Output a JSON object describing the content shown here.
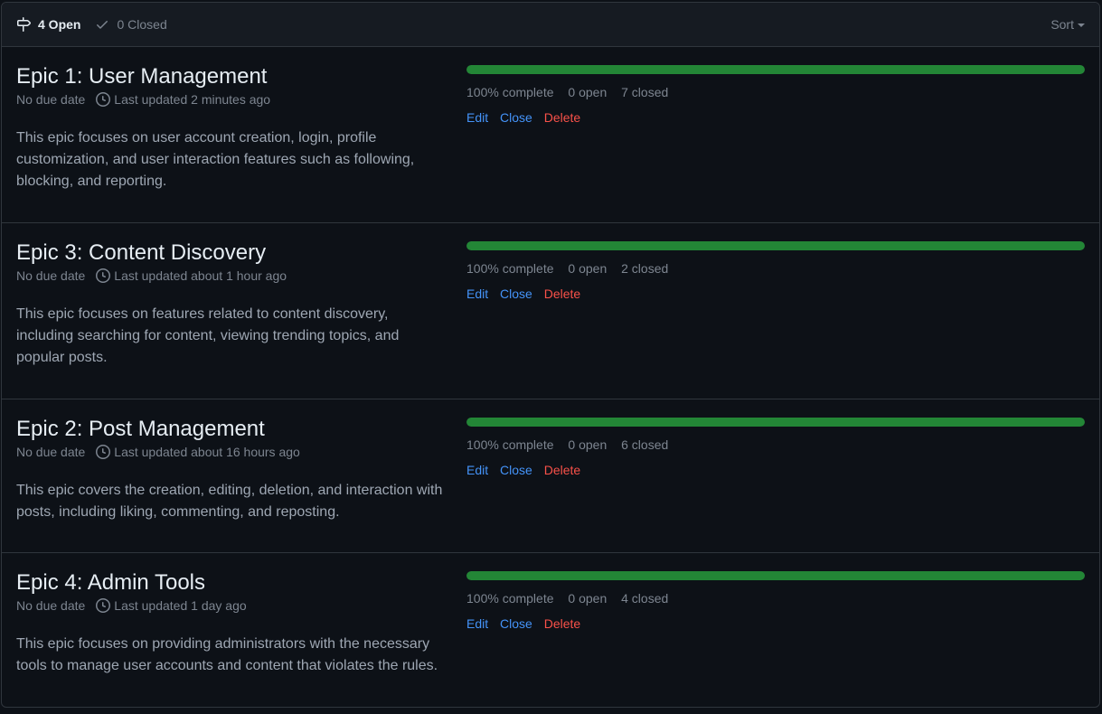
{
  "header": {
    "open_label": "4 Open",
    "closed_label": "0 Closed",
    "sort_label": "Sort"
  },
  "colors": {
    "progress": "#238636",
    "link": "#4493f8",
    "danger": "#f85149"
  },
  "milestones": [
    {
      "title": "Epic 1: User Management",
      "due": "No due date",
      "updated": "Last updated 2 minutes ago",
      "description": "This epic focuses on user account creation, login, profile customization, and user interaction features such as following, blocking, and reporting.",
      "percent_label": "100% complete",
      "percent": 100,
      "open_label": "0 open",
      "closed_label": "7 closed",
      "edit": "Edit",
      "close": "Close",
      "delete": "Delete"
    },
    {
      "title": "Epic 3: Content Discovery",
      "due": "No due date",
      "updated": "Last updated about 1 hour ago",
      "description": "This epic focuses on features related to content discovery, including searching for content, viewing trending topics, and popular posts.",
      "percent_label": "100% complete",
      "percent": 100,
      "open_label": "0 open",
      "closed_label": "2 closed",
      "edit": "Edit",
      "close": "Close",
      "delete": "Delete"
    },
    {
      "title": "Epic 2: Post Management",
      "due": "No due date",
      "updated": "Last updated about 16 hours ago",
      "description": "This epic covers the creation, editing, deletion, and interaction with posts, including liking, commenting, and reposting.",
      "percent_label": "100% complete",
      "percent": 100,
      "open_label": "0 open",
      "closed_label": "6 closed",
      "edit": "Edit",
      "close": "Close",
      "delete": "Delete"
    },
    {
      "title": "Epic 4: Admin Tools",
      "due": "No due date",
      "updated": "Last updated 1 day ago",
      "description": "This epic focuses on providing administrators with the necessary tools to manage user accounts and content that violates the rules.",
      "percent_label": "100% complete",
      "percent": 100,
      "open_label": "0 open",
      "closed_label": "4 closed",
      "edit": "Edit",
      "close": "Close",
      "delete": "Delete"
    }
  ]
}
